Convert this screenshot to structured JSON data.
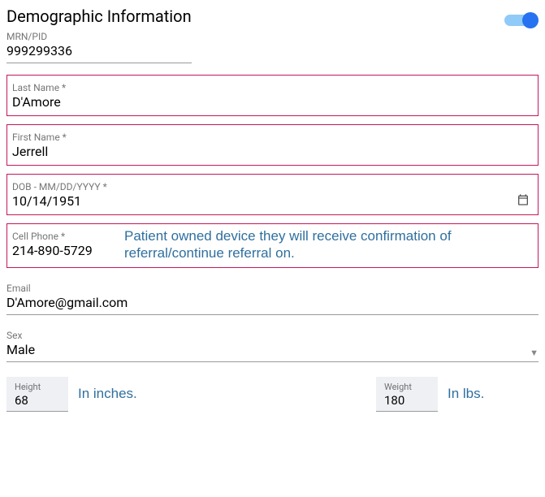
{
  "header": {
    "title": "Demographic Information",
    "toggle_on": true
  },
  "mrn": {
    "label": "MRN/PID",
    "value": "999299336"
  },
  "last_name": {
    "label": "Last Name",
    "required_marker": "*",
    "value": "D'Amore"
  },
  "first_name": {
    "label": "First Name",
    "required_marker": "*",
    "value": "Jerrell"
  },
  "dob": {
    "label": "DOB - MM/DD/YYYY",
    "required_marker": "*",
    "value": "10/14/1951"
  },
  "cell": {
    "label": "Cell Phone",
    "required_marker": "*",
    "value": "214-890-5729",
    "hint": "Patient owned device they will receive confirmation of referral/continue referral on."
  },
  "email": {
    "label": "Email",
    "value": "D'Amore@gmail.com"
  },
  "sex": {
    "label": "Sex",
    "value": "Male"
  },
  "height": {
    "label": "Height",
    "value": "68",
    "hint": "In inches."
  },
  "weight": {
    "label": "Weight",
    "value": "180",
    "hint": "In lbs."
  }
}
